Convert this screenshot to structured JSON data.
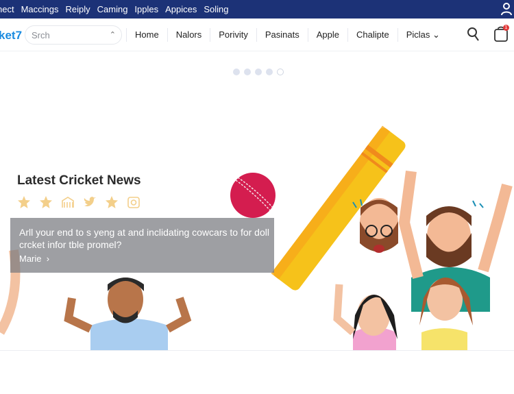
{
  "topbar": {
    "links": [
      "nect",
      "Maccings",
      "Reiply",
      "Caming",
      "Ipples",
      "Appices",
      "Soling"
    ]
  },
  "nav": {
    "logo": "ket7",
    "search_placeholder": "Srch",
    "items": [
      "Home",
      "Nalors",
      "Porivity",
      "Pasinats",
      "Apple",
      "Chalipte",
      "Piclas"
    ],
    "cart_badge": "1"
  },
  "carousel": {
    "slides": 5,
    "active": 5
  },
  "hero": {
    "title": "Latest Cricket News",
    "description": "Arll your end to s yeng at and inclidating cowcars to for doll crcket infor tble promel?",
    "more_label": "Marie"
  },
  "colors": {
    "topbar": "#1c3277",
    "accent": "#1a8be0",
    "badge": "#e03a3a"
  }
}
